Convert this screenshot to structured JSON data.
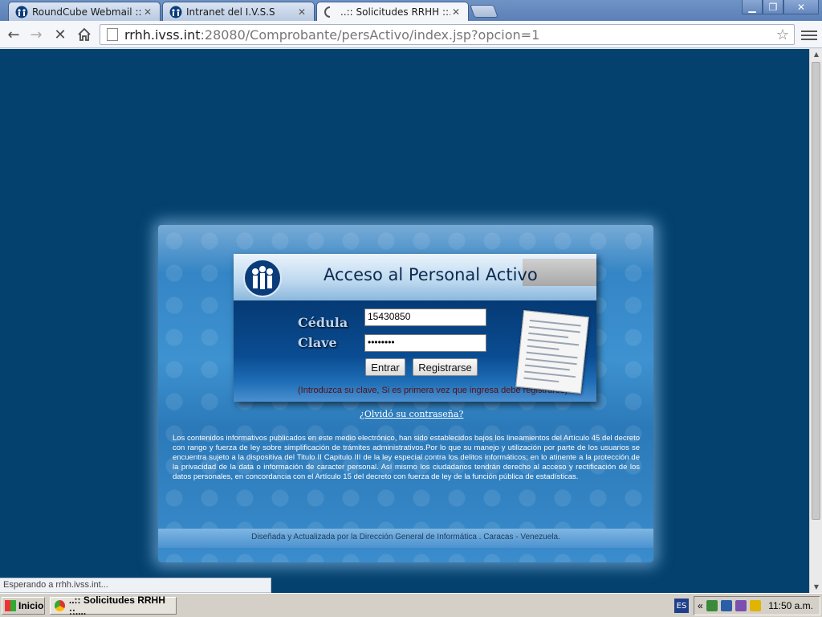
{
  "browser": {
    "tabs": [
      {
        "label": "RoundCube Webmail :: Envia",
        "close": "✕"
      },
      {
        "label": "Intranet del I.V.S.S",
        "close": "✕"
      },
      {
        "label": "..:: Solicitudes RRHH ::...",
        "close": "✕"
      }
    ],
    "url_host": "rrhh.ivss.int",
    "url_rest": ":28080/Comprobante/persActivo/index.jsp?opcion=1",
    "status_text": "Esperando a rrhh.ivss.int..."
  },
  "login": {
    "title": "Acceso al Personal Activo",
    "cedula_label": "Cédula",
    "clave_label": "Clave",
    "cedula_value": "15430850",
    "clave_value": "••••••••",
    "enter_button": "Entrar",
    "register_button": "Registrarse",
    "hint": "(Introduzca su clave, Si es primera vez que ingresa debe registrarse)",
    "forgot_link": "¿Olvidó su contraseña?"
  },
  "legal_text": "Los contenidos informativos publicados en este medio electrónico, han sido establecidos bajos los lineamientos del Artículo 45 del decreto con rango y fuerza de ley sobre simplificación de trámites administrativos.Por lo que su manejo y utilización por parte de los usuarios se encuentra sujeto a la dispositiva del Titulo II Capitulo III de la ley especial contra los delitos informáticos; en lo atinente a la protección de la privacidad de la data o información de caracter personal. Así mismo los ciudadanos tendrán derecho al acceso y rectificación de los datos personales, en concordancia con el Artículo 15 del decreto con fuerza de ley de la función pública de estadísticas.",
  "footer_text": "Diseñada y Actualizada por la Dirección General de Informática . Caracas - Venezuela.",
  "taskbar": {
    "start_label": "Inicio",
    "task_label": "..:: Solicitudes RRHH ::....",
    "lang": "ES",
    "clock": "11:50 a.m."
  },
  "colors": {
    "page_background": "#04416e",
    "panel_blue": "#3e92d0",
    "login_dark": "#053a74"
  }
}
